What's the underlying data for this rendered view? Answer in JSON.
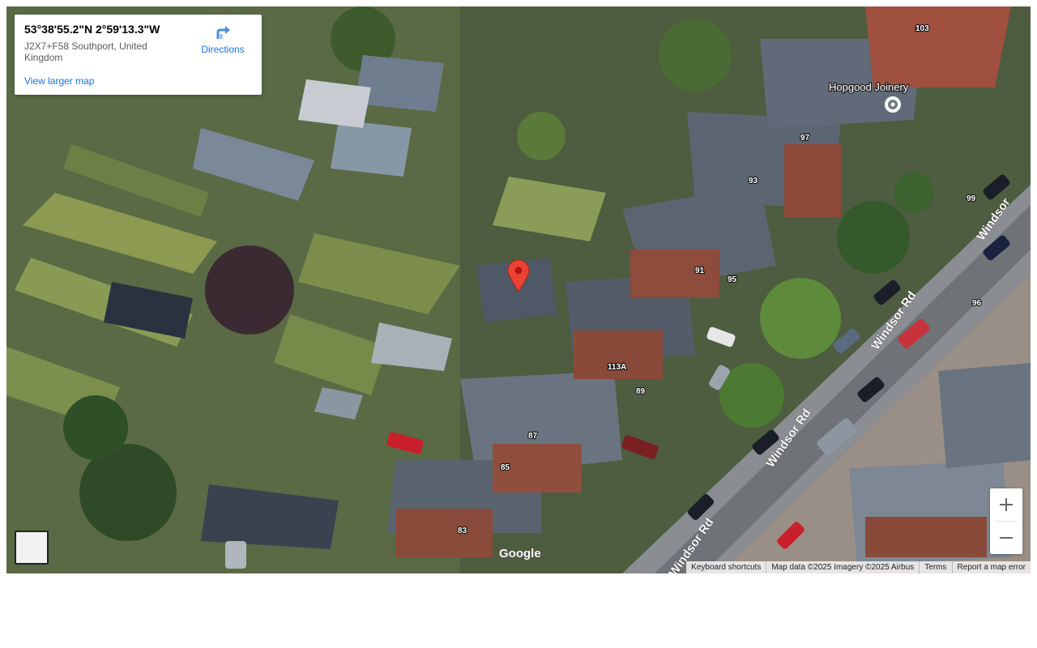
{
  "info_card": {
    "coordinates": "53°38'55.2\"N 2°59'13.3\"W",
    "address": "J2X7+F58 Southport, United Kingdom",
    "view_larger": "View larger map",
    "directions": "Directions"
  },
  "map": {
    "type": "satellite",
    "road_labels": [
      "Windsor Rd",
      "Windsor Rd",
      "Windsor Rd",
      "Windsor"
    ],
    "house_numbers": [
      "103",
      "99",
      "97",
      "93",
      "91",
      "95",
      "96",
      "113A",
      "89",
      "87",
      "85",
      "83"
    ],
    "poi": {
      "name": "Hopgood Joinery",
      "icon": "place-pin-icon"
    },
    "marker": {
      "icon": "red-location-pin-icon",
      "color": "#ea4335"
    },
    "logo": "Google"
  },
  "controls": {
    "zoom_in_icon": "plus-icon",
    "zoom_out_icon": "minus-icon",
    "layer_icon": "satellite-layer-thumbnail"
  },
  "attribution": {
    "keyboard": "Keyboard shortcuts",
    "map_data": "Map data ©2025 Imagery ©2025 Airbus",
    "terms": "Terms",
    "report": "Report a map error"
  }
}
